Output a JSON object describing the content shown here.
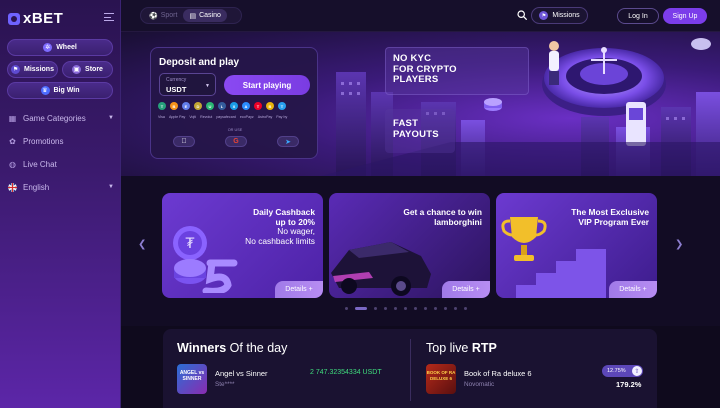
{
  "brand": {
    "logo_text": "xBET"
  },
  "sidebar": {
    "quick": {
      "wheel": "Wheel",
      "missions": "Missions",
      "store": "Store",
      "big_win": "Big Win"
    },
    "nav": [
      {
        "label": "Game Categories"
      },
      {
        "label": "Promotions"
      },
      {
        "label": "Live Chat"
      },
      {
        "label": "English"
      }
    ]
  },
  "topbar": {
    "tabs": [
      {
        "label": "Sport"
      },
      {
        "label": "Casino"
      }
    ],
    "active_tab": "Casino",
    "missions_label": "Missions",
    "login_label": "Log In",
    "signup_label": "Sign Up"
  },
  "hero": {
    "deposit_title": "Deposit and play",
    "currency_label": "Currency",
    "currency_value": "USDT",
    "start_label": "Start playing",
    "or_with": "OR USE",
    "payments": [
      "Visa",
      "Apple Pay",
      "Vojti",
      "Revolut",
      "paysafecard",
      "ecoPayz",
      "AstroPay",
      "Pay by",
      "Bank Transfer"
    ],
    "promo_line1": "NO KYC",
    "promo_line2": "FOR CRYPTO",
    "promo_line3": "PLAYERS",
    "promo2_line1": "FAST",
    "promo2_line2": "PAYOUTS"
  },
  "carousel": {
    "cards": [
      {
        "line1": "Daily Cashback",
        "line2": "up to 20%",
        "line3": "No wager,",
        "line4": "No cashback limits",
        "details": "Details"
      },
      {
        "line1": "Get a chance to win",
        "line2": "lamborghini",
        "details": "Details"
      },
      {
        "line1": "The Most Exclusive",
        "line2": "VIP Program Ever",
        "details": "Details"
      }
    ],
    "active_dot": 1,
    "dot_count": 12
  },
  "winners": {
    "title_bold": "Winners",
    "title_rest": " Of the day",
    "entry": {
      "game": "Angel vs Sinner",
      "user": "Ste****",
      "amount": "2 747.32354334 USDT",
      "thumb_text": "ANGEL vs SINNER"
    }
  },
  "rtp": {
    "title_prefix": "Top live ",
    "title_bold": "RTP",
    "entry": {
      "game": "Book of Ra deluxe 6",
      "provider": "Novomatic",
      "badge": "12.75%",
      "value": "179.2%",
      "thumb_text": "BOOK OF RA DELUXE 6"
    }
  },
  "colors": {
    "accent": "#7b3dea",
    "win_green": "#3fdc7d",
    "sidebar_bg": "#3a1a6c",
    "page_bg": "#0f0a1d"
  }
}
